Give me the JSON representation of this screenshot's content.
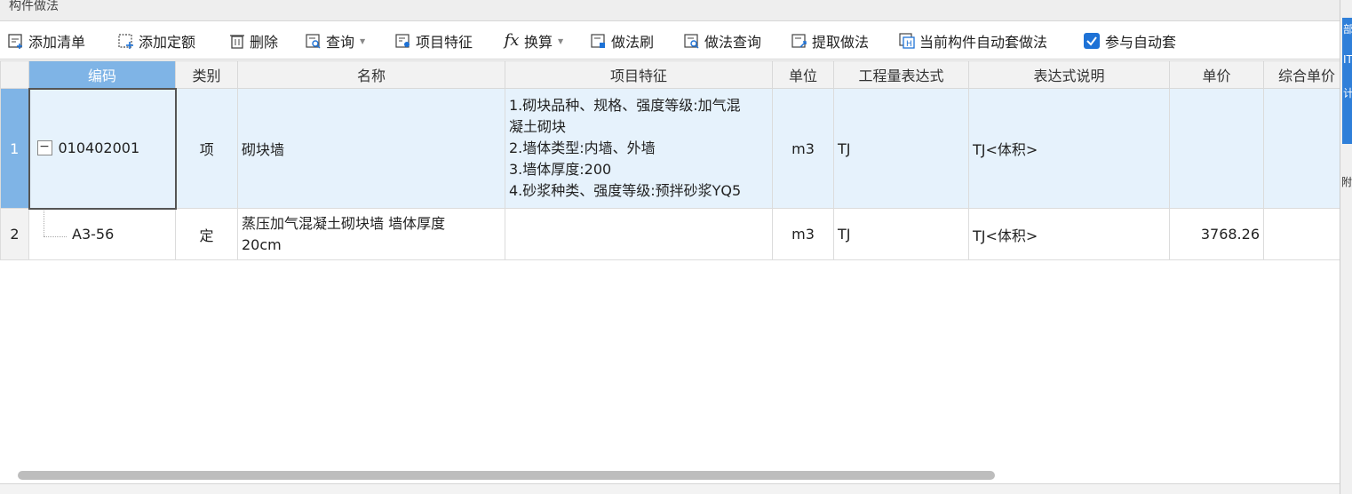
{
  "panel": {
    "title": "构件做法"
  },
  "toolbar": {
    "add_list": "添加清单",
    "add_quota": "添加定额",
    "delete": "删除",
    "query": "查询",
    "item_feature": "项目特征",
    "convert": "换算",
    "method_brush": "做法刷",
    "method_query": "做法查询",
    "extract_method": "提取做法",
    "auto_apply_current": "当前构件自动套做法",
    "join_auto_apply": "参与自动套",
    "join_auto_apply_checked": true
  },
  "table": {
    "headers": [
      "编码",
      "类别",
      "名称",
      "项目特征",
      "单位",
      "工程量表达式",
      "表达式说明",
      "单价",
      "综合单价"
    ],
    "rows": [
      {
        "num": "1",
        "code": "010402001",
        "type": "项",
        "name": "砌块墙",
        "features": [
          "1.砌块品种、规格、强度等级:加气混",
          "凝土砌块",
          "2.墙体类型:内墙、外墙",
          "3.墙体厚度:200",
          "4.砂浆种类、强度等级:预拌砂浆YQ5"
        ],
        "unit": "m3",
        "expression": "TJ",
        "expression_desc": "TJ<体积>",
        "price": "",
        "total_price": ""
      },
      {
        "num": "2",
        "code": "A3-56",
        "type": "定",
        "name_line1": "蒸压加气混凝土砌块墙 墙体厚度",
        "name_line2": "20cm",
        "features": "",
        "unit": "m3",
        "expression": "TJ",
        "expression_desc": "TJ<体积>",
        "price": "3768.26",
        "total_price": ""
      }
    ]
  },
  "right_strip": {
    "glyphs": [
      "部",
      "IT",
      "计",
      "附"
    ]
  },
  "colors": {
    "accent": "#1e72d6",
    "selected_header": "#7fb4e6",
    "selected_row": "#e6f2fc"
  }
}
